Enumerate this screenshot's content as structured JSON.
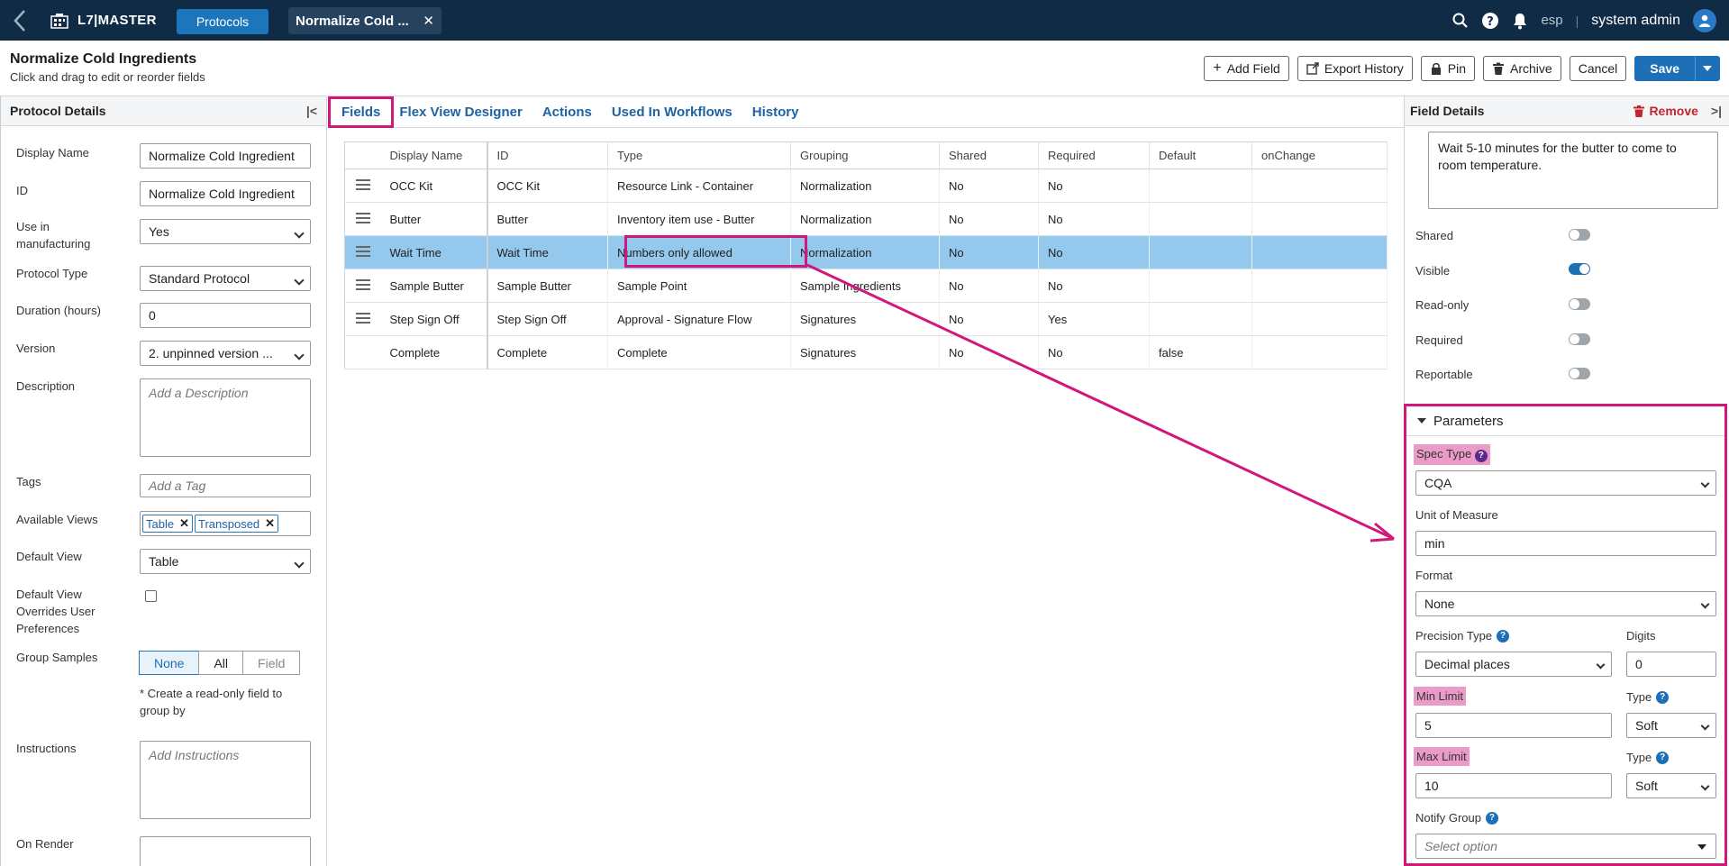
{
  "topbar": {
    "brand": "L7|MASTER",
    "nav_protocols": "Protocols",
    "doc_tab": "Normalize Cold ...",
    "lang": "esp",
    "separator": "|",
    "user": "system admin"
  },
  "header": {
    "title": "Normalize Cold Ingredients",
    "subtitle": "Click and drag to edit or reorder fields",
    "buttons": {
      "add_field": "Add Field",
      "export_history": "Export History",
      "pin": "Pin",
      "archive": "Archive",
      "cancel": "Cancel",
      "save": "Save"
    }
  },
  "left_panel": {
    "title": "Protocol Details",
    "fields": {
      "display_name_label": "Display Name",
      "display_name_value": "Normalize Cold Ingredient",
      "id_label": "ID",
      "id_value": "Normalize Cold Ingredient",
      "use_mfg_label": "Use in manufacturing",
      "use_mfg_value": "Yes",
      "protocol_type_label": "Protocol Type",
      "protocol_type_value": "Standard Protocol",
      "duration_label": "Duration (hours)",
      "duration_value": "0",
      "version_label": "Version",
      "version_value": "2. unpinned version ...",
      "description_label": "Description",
      "description_placeholder": "Add a Description",
      "tags_label": "Tags",
      "tags_placeholder": "Add a Tag",
      "available_views_label": "Available Views",
      "available_views": [
        "Table",
        "Transposed"
      ],
      "default_view_label": "Default View",
      "default_view_value": "Table",
      "override_label": "Default View Overrides User Preferences",
      "group_samples_label": "Group Samples",
      "group_samples_options": [
        "None",
        "All",
        "Field"
      ],
      "group_samples_note": "* Create a read-only field to group by",
      "instructions_label": "Instructions",
      "instructions_placeholder": "Add Instructions",
      "on_render_label": "On Render"
    }
  },
  "tabs": [
    "Fields",
    "Flex View Designer",
    "Actions",
    "Used In Workflows",
    "History"
  ],
  "grid": {
    "columns": [
      "Display Name",
      "ID",
      "Type",
      "Grouping",
      "Shared",
      "Required",
      "Default",
      "onChange"
    ],
    "rows": [
      {
        "name": "OCC Kit",
        "id": "OCC Kit",
        "type": "Resource Link - Container",
        "grouping": "Normalization",
        "shared": "No",
        "required": "No",
        "default": "",
        "onchange": "",
        "handle": true
      },
      {
        "name": "Butter",
        "id": "Butter",
        "type": "Inventory item use - Butter",
        "grouping": "Normalization",
        "shared": "No",
        "required": "No",
        "default": "",
        "onchange": "",
        "handle": true
      },
      {
        "name": "Wait Time",
        "id": "Wait Time",
        "type": "Numbers only allowed",
        "grouping": "Normalization",
        "shared": "No",
        "required": "No",
        "default": "",
        "onchange": "",
        "handle": true
      },
      {
        "name": "Sample Butter",
        "id": "Sample Butter",
        "type": "Sample Point",
        "grouping": "Sample Ingredients",
        "shared": "No",
        "required": "No",
        "default": "",
        "onchange": "",
        "handle": true
      },
      {
        "name": "Step Sign Off",
        "id": "Step Sign Off",
        "type": "Approval - Signature Flow",
        "grouping": "Signatures",
        "shared": "No",
        "required": "Yes",
        "default": "",
        "onchange": "",
        "handle": true
      },
      {
        "name": "Complete",
        "id": "Complete",
        "type": "Complete",
        "grouping": "Signatures",
        "shared": "No",
        "required": "No",
        "default": "false",
        "onchange": "",
        "handle": false
      }
    ]
  },
  "right_panel": {
    "title": "Field Details",
    "remove": "Remove",
    "instructions_text": "Wait 5-10 minutes for the butter to come to room temperature.",
    "toggles": [
      {
        "label": "Shared",
        "on": false
      },
      {
        "label": "Visible",
        "on": true
      },
      {
        "label": "Read-only",
        "on": false
      },
      {
        "label": "Required",
        "on": false
      },
      {
        "label": "Reportable",
        "on": false
      }
    ],
    "parameters": {
      "title": "Parameters",
      "spec_type_label": "Spec Type",
      "spec_type_value": "CQA",
      "uom_label": "Unit of Measure",
      "uom_value": "min",
      "format_label": "Format",
      "format_value": "None",
      "precision_label": "Precision Type",
      "precision_value": "Decimal places",
      "digits_label": "Digits",
      "digits_value": "0",
      "min_label": "Min Limit",
      "min_value": "5",
      "min_type_label": "Type",
      "min_type_value": "Soft",
      "max_label": "Max Limit",
      "max_value": "10",
      "max_type_label": "Type",
      "max_type_value": "Soft",
      "notify_label": "Notify Group",
      "notify_placeholder": "Select option"
    }
  },
  "colors": {
    "topbar": "#0f2b45",
    "accent": "#1d6fb8",
    "highlight": "#d1187a",
    "selected_row": "#94c8ec"
  }
}
